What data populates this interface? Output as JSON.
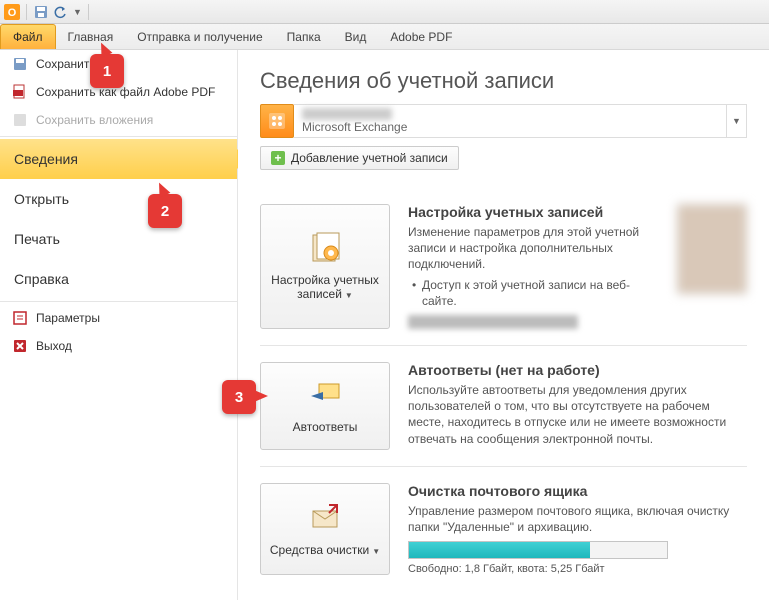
{
  "titlebar": {
    "app_icon": "O"
  },
  "ribbon": {
    "tabs": [
      "Файл",
      "Главная",
      "Отправка и получение",
      "Папка",
      "Вид",
      "Adobe PDF"
    ],
    "active": 0
  },
  "sidebar": {
    "save": "Сохранить",
    "save_pdf": "Сохранить как файл Adobe PDF",
    "save_attachments": "Сохранить вложения",
    "info": "Сведения",
    "open": "Открыть",
    "print": "Печать",
    "help": "Справка",
    "options": "Параметры",
    "exit": "Выход"
  },
  "page": {
    "title": "Сведения об учетной записи",
    "account_type": "Microsoft Exchange",
    "add_account": "Добавление учетной записи"
  },
  "sections": {
    "settings": {
      "btn": "Настройка учетных записей",
      "heading": "Настройка учетных записей",
      "desc": "Изменение параметров для этой учетной записи и настройка дополнительных подключений.",
      "bullet": "Доступ к этой учетной записи на веб-сайте."
    },
    "autoreply": {
      "btn": "Автоответы",
      "heading": "Автоответы (нет на работе)",
      "desc": "Используйте автоответы для уведомления других пользователей о том, что вы отсутствуете на рабочем месте, находитесь в отпуске или не имеете возможности отвечать на сообщения электронной почты."
    },
    "cleanup": {
      "btn": "Средства очистки",
      "heading": "Очистка почтового ящика",
      "desc": "Управление размером почтового ящика, включая очистку папки \"Удаленные\" и архивацию.",
      "progress_pct": 70,
      "progress_text": "Свободно: 1,8 Гбайт, квота: 5,25 Гбайт"
    }
  },
  "callouts": {
    "c1": "1",
    "c2": "2",
    "c3": "3"
  }
}
